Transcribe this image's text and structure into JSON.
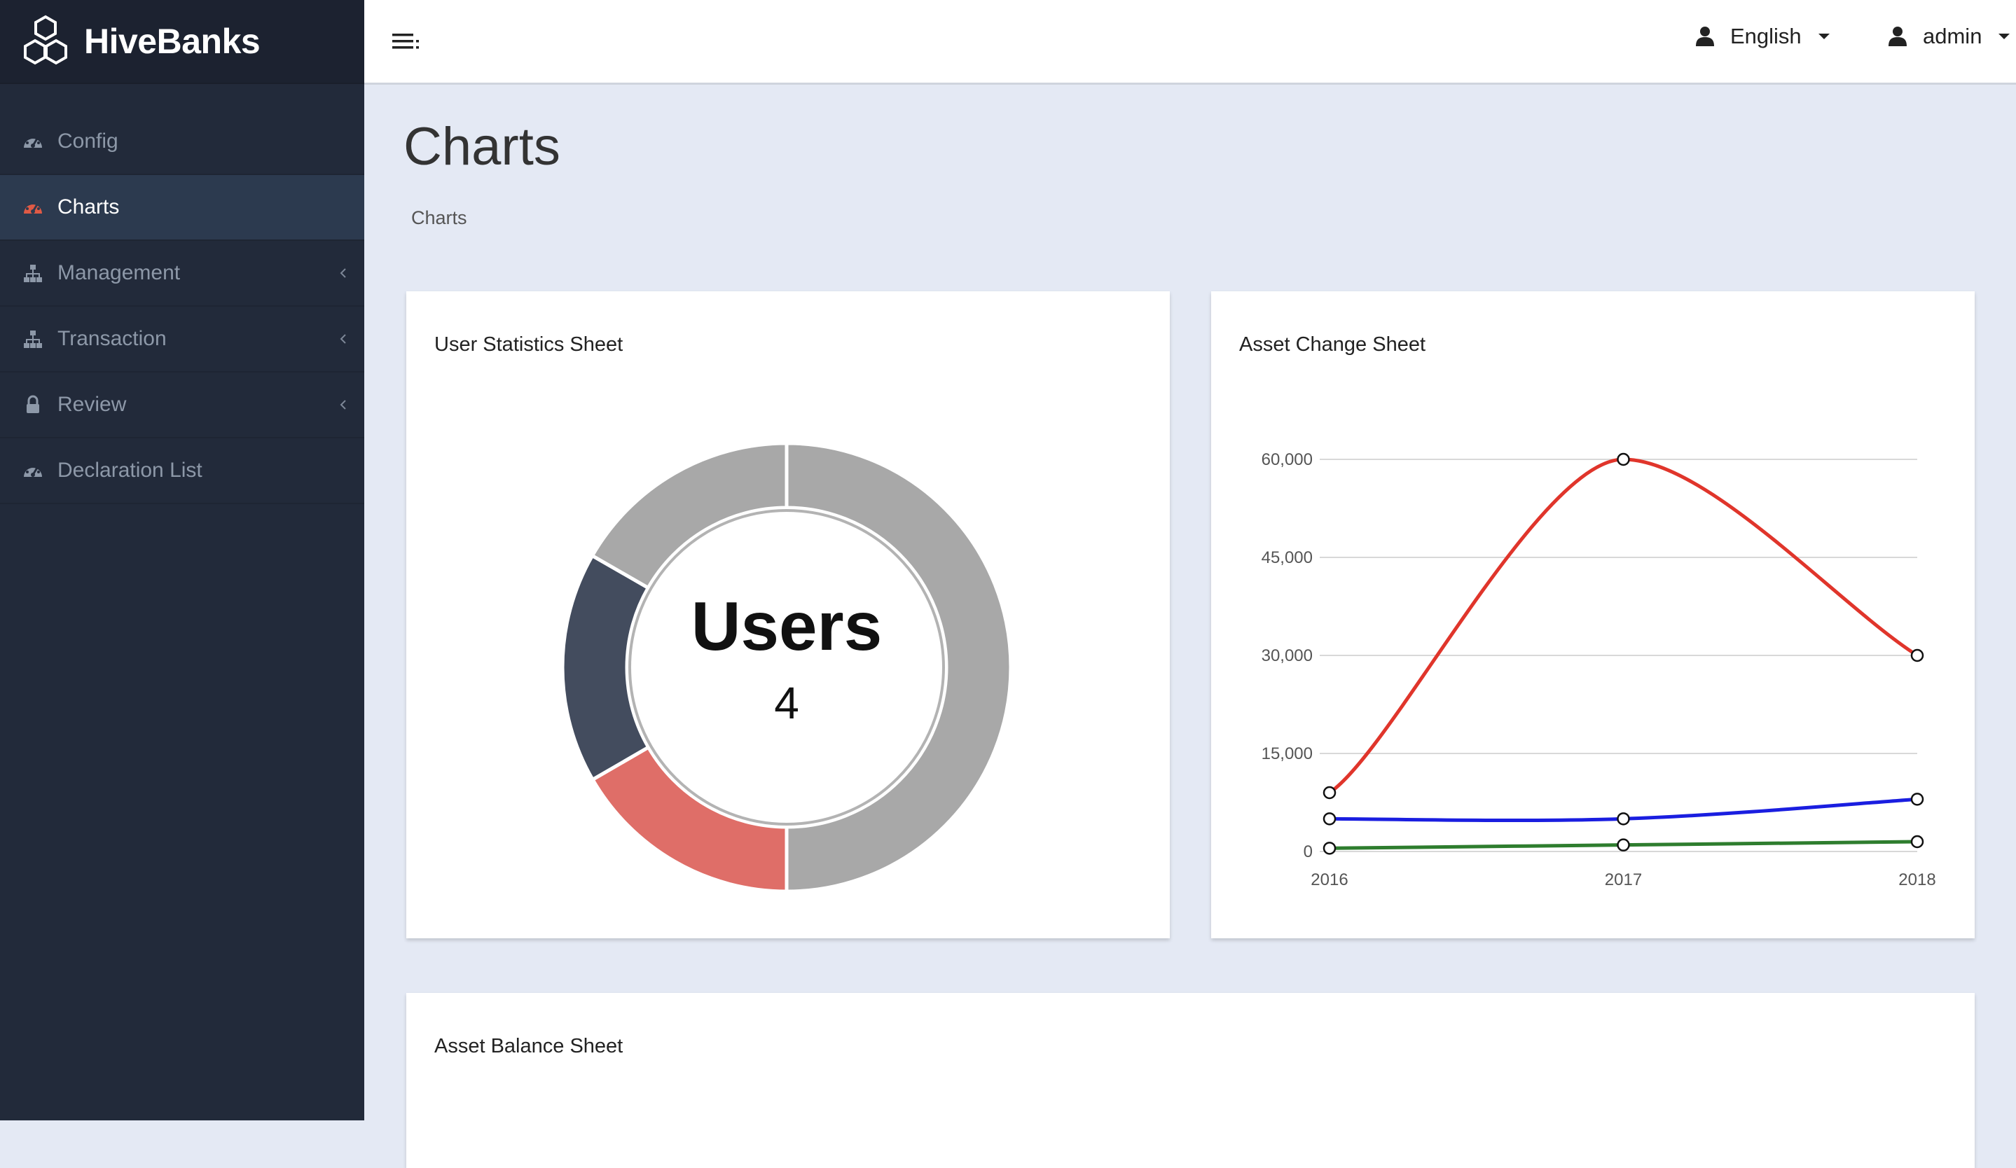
{
  "brand": {
    "name": "HiveBanks"
  },
  "sidebar": {
    "items": [
      {
        "label": "Config",
        "icon": "dashboard-icon",
        "active": false,
        "has_submenu": false
      },
      {
        "label": "Charts",
        "icon": "dashboard-icon",
        "active": true,
        "has_submenu": false
      },
      {
        "label": "Management",
        "icon": "sitemap-icon",
        "active": false,
        "has_submenu": true
      },
      {
        "label": "Transaction",
        "icon": "sitemap-icon",
        "active": false,
        "has_submenu": true
      },
      {
        "label": "Review",
        "icon": "lock-icon",
        "active": false,
        "has_submenu": true
      },
      {
        "label": "Declaration List",
        "icon": "dashboard-icon",
        "active": false,
        "has_submenu": false
      }
    ]
  },
  "topbar": {
    "language": "English",
    "user": "admin"
  },
  "page": {
    "title": "Charts",
    "breadcrumb": "Charts"
  },
  "colors": {
    "sidebar_bg": "#222a3a",
    "active_icon": "#e05a45",
    "page_bg": "#e4e9f4"
  },
  "chart_data": [
    {
      "type": "pie",
      "title": "User Statistics Sheet",
      "center_label": "Users",
      "center_value": "4",
      "slices": [
        {
          "value": 2,
          "color": "#a8a8a8"
        },
        {
          "value": 0.666,
          "color": "#df6e68"
        },
        {
          "value": 0.666,
          "color": "#434c5e"
        },
        {
          "value": 0.668,
          "color": "#a8a8a8"
        }
      ],
      "legend": false
    },
    {
      "type": "line",
      "title": "Asset Change Sheet",
      "x": [
        "2016",
        "2017",
        "2018"
      ],
      "series": [
        {
          "color": "#e0352b",
          "values": [
            9000,
            60000,
            30000
          ]
        },
        {
          "color": "#1a1ee0",
          "values": [
            5000,
            5000,
            8000
          ]
        },
        {
          "color": "#2e7d2e",
          "values": [
            500,
            1000,
            1500
          ]
        }
      ],
      "ylim": [
        0,
        60000
      ],
      "yticks": [
        "0",
        "15,000",
        "30,000",
        "45,000",
        "60,000"
      ],
      "ytick_values": [
        0,
        15000,
        30000,
        45000,
        60000
      ],
      "grid": true,
      "legend": false
    },
    {
      "type": "bar",
      "title": "Asset Balance Sheet"
    }
  ]
}
